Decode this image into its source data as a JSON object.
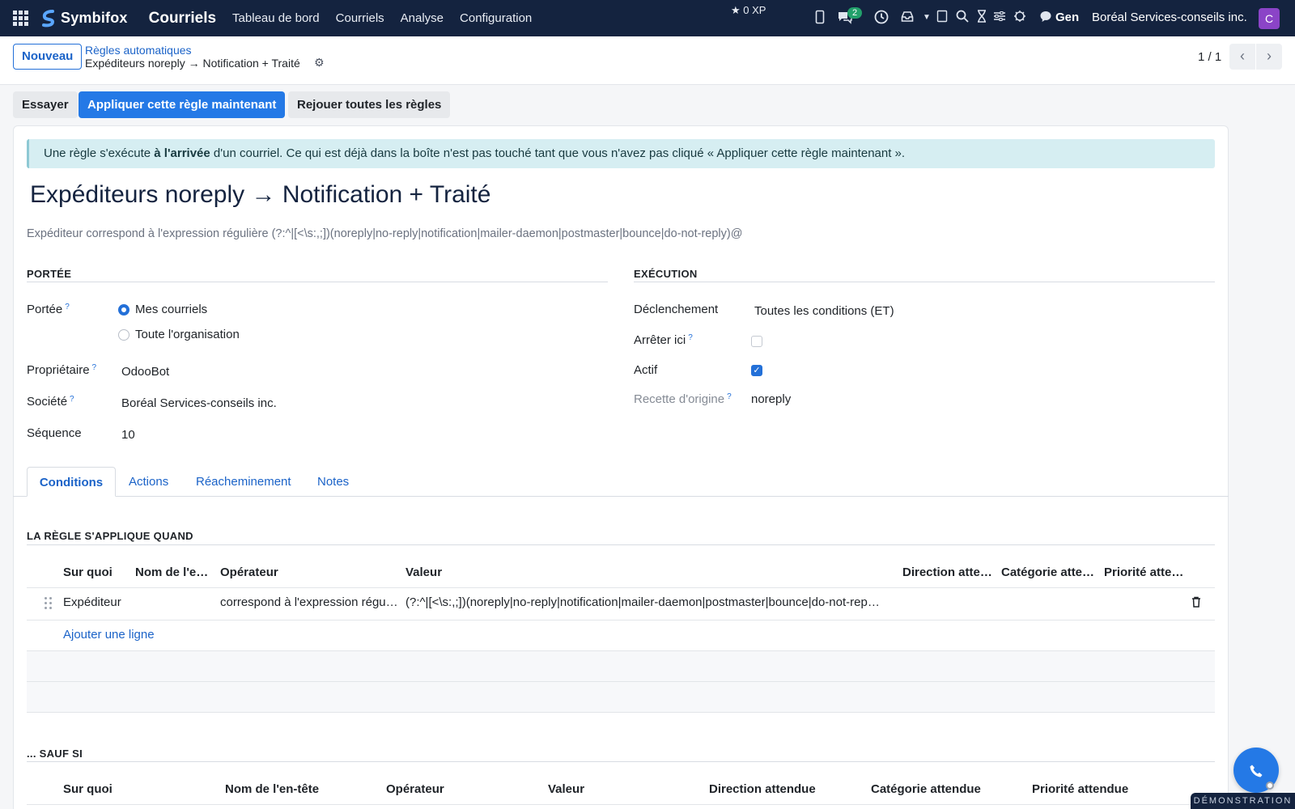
{
  "navbar": {
    "brand": "Symbifox",
    "app_name": "Courriels",
    "menu": [
      "Tableau de bord",
      "Courriels",
      "Analyse",
      "Configuration"
    ],
    "xp": "0 XP",
    "chat_badge": "2",
    "gen_label": "Gen",
    "company": "Boréal Services-conseils inc.",
    "avatar_initial": "C",
    "icons": [
      "apps-icon",
      "mobile-icon",
      "chat-icon",
      "clock-icon",
      "inbox-icon",
      "caret-down-icon",
      "tablet-icon",
      "search-icon",
      "hourglass-icon",
      "sliders-icon",
      "bug-icon",
      "gen-chat-icon"
    ]
  },
  "control_panel": {
    "new_button": "Nouveau",
    "breadcrumb_parent": "Règles automatiques",
    "breadcrumb_current": "Expéditeurs noreply → Notification + Traité",
    "pager": "1 / 1"
  },
  "actions": {
    "try": "Essayer",
    "apply": "Appliquer cette règle maintenant",
    "replay": "Rejouer toutes les règles"
  },
  "alert": {
    "before": "Une règle s'exécute ",
    "bold": "à l'arrivée",
    "after": " d'un courriel. Ce qui est déjà dans la boîte n'est pas touché tant que vous n'avez pas cliqué « Appliquer cette règle maintenant »."
  },
  "rule": {
    "title": "Expéditeurs noreply → Notification + Traité",
    "summary": "Expéditeur correspond à l'expression régulière (?:^|[<\\s:,;])(noreply|no-reply|notification|mailer-daemon|postmaster|bounce|do-not-reply)@"
  },
  "scope_section": {
    "heading": "PORTÉE",
    "scope_label": "Portée",
    "scope_options": [
      "Mes courriels",
      "Toute l'organisation"
    ],
    "scope_selected": "Mes courriels",
    "owner_label": "Propriétaire",
    "owner_value": "OdooBot",
    "company_label": "Société",
    "company_value": "Boréal Services-conseils inc.",
    "sequence_label": "Séquence",
    "sequence_value": "10"
  },
  "execution_section": {
    "heading": "EXÉCUTION",
    "trigger_label": "Déclenchement",
    "trigger_value": "Toutes les conditions (ET)",
    "stop_label": "Arrêter ici",
    "stop_checked": false,
    "active_label": "Actif",
    "active_checked": true,
    "origin_label": "Recette d'origine",
    "origin_value": "noreply"
  },
  "tabs": [
    "Conditions",
    "Actions",
    "Réacheminement",
    "Notes"
  ],
  "conditions": {
    "heading": "LA RÈGLE S'APPLIQUE QUAND",
    "columns": [
      "Sur quoi",
      "Nom de l'en…",
      "Opérateur",
      "Valeur",
      "Direction atte…",
      "Catégorie atte…",
      "Priorité atte…"
    ],
    "rows": [
      {
        "on": "Expéditeur",
        "header_name": "",
        "operator": "correspond à l'expression régu…",
        "value": "(?:^|[<\\s:,;])(noreply|no-reply|notification|mailer-daemon|postmaster|bounce|do-not-rep…",
        "direction": "",
        "category": "",
        "priority": ""
      }
    ],
    "add_line": "Ajouter une ligne"
  },
  "exceptions": {
    "heading": "... SAUF SI",
    "columns": [
      "Sur quoi",
      "Nom de l'en-tête",
      "Opérateur",
      "Valeur",
      "Direction attendue",
      "Catégorie attendue",
      "Priorité attendue"
    ]
  },
  "footer": {
    "demo_label": "DÉMONSTRATION"
  },
  "colors": {
    "navbar": "#14233f",
    "primary": "#2479e6",
    "link": "#1b63c8",
    "alert_bg": "#d6eef2"
  }
}
